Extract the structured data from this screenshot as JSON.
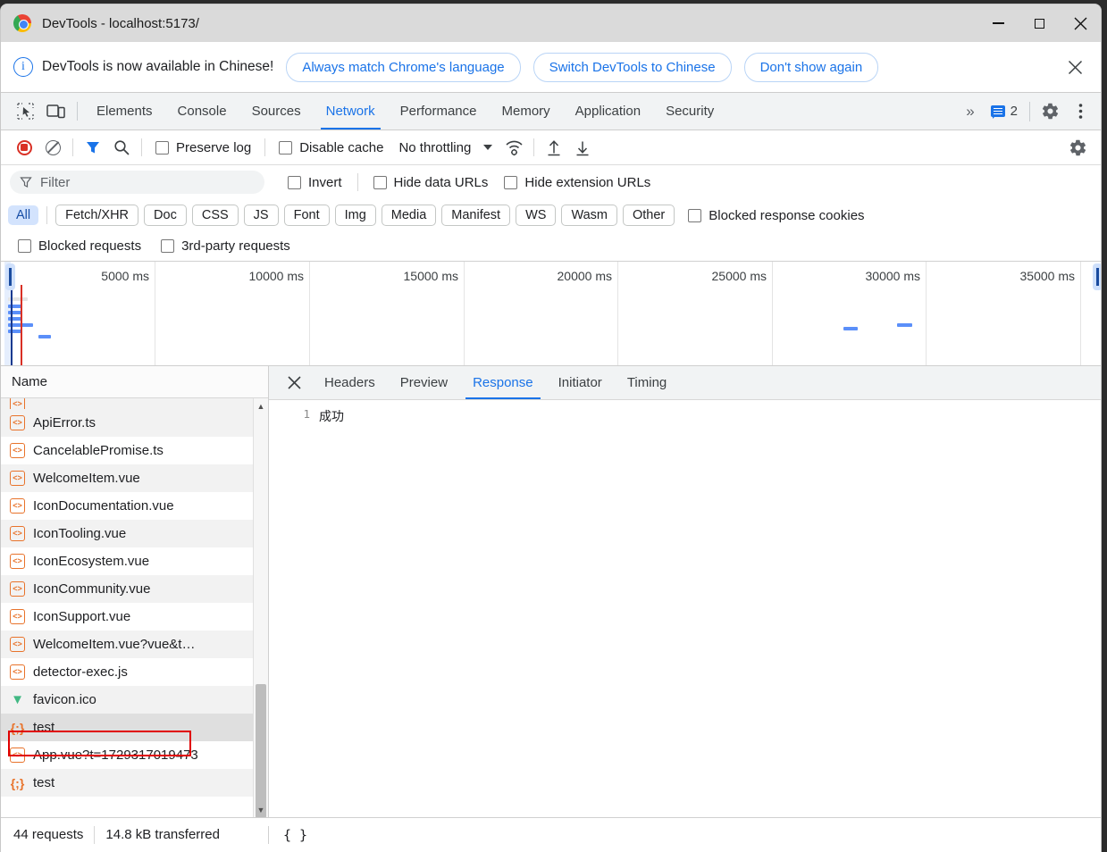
{
  "window": {
    "title": "DevTools - localhost:5173/",
    "minimize": "minimize-button",
    "maximize": "maximize-button",
    "close": "close-button"
  },
  "infobar": {
    "message": "DevTools is now available in Chinese!",
    "buttons": [
      "Always match Chrome's language",
      "Switch DevTools to Chinese",
      "Don't show again"
    ],
    "close_label": "✕"
  },
  "tabstrip": {
    "tabs": [
      "Elements",
      "Console",
      "Sources",
      "Network",
      "Performance",
      "Memory",
      "Application",
      "Security"
    ],
    "active": "Network",
    "more_label": "»",
    "message_count": "2"
  },
  "toolbar": {
    "preserve_log": "Preserve log",
    "disable_cache": "Disable cache",
    "throttling": "No throttling"
  },
  "filterbar": {
    "placeholder": "Filter",
    "invert": "Invert",
    "hide_data_urls": "Hide data URLs",
    "hide_extension_urls": "Hide extension URLs"
  },
  "chips": {
    "items": [
      "All",
      "Fetch/XHR",
      "Doc",
      "CSS",
      "JS",
      "Font",
      "Img",
      "Media",
      "Manifest",
      "WS",
      "Wasm",
      "Other"
    ],
    "active": "All",
    "blocked_response_cookies": "Blocked response cookies"
  },
  "checkrow": {
    "blocked_requests": "Blocked requests",
    "third_party_requests": "3rd-party requests"
  },
  "overview": {
    "ticks": [
      "5000 ms",
      "10000 ms",
      "15000 ms",
      "20000 ms",
      "25000 ms",
      "30000 ms",
      "35000 ms"
    ]
  },
  "requests": {
    "column_header": "Name",
    "rows": [
      {
        "name": "",
        "icon": "code-icon",
        "partial": true
      },
      {
        "name": "ApiError.ts",
        "icon": "code-icon"
      },
      {
        "name": "CancelablePromise.ts",
        "icon": "code-icon"
      },
      {
        "name": "WelcomeItem.vue",
        "icon": "code-icon"
      },
      {
        "name": "IconDocumentation.vue",
        "icon": "code-icon"
      },
      {
        "name": "IconTooling.vue",
        "icon": "code-icon"
      },
      {
        "name": "IconEcosystem.vue",
        "icon": "code-icon"
      },
      {
        "name": "IconCommunity.vue",
        "icon": "code-icon"
      },
      {
        "name": "IconSupport.vue",
        "icon": "code-icon"
      },
      {
        "name": "WelcomeItem.vue?vue&t…",
        "icon": "code-icon"
      },
      {
        "name": "detector-exec.js",
        "icon": "code-icon"
      },
      {
        "name": "favicon.ico",
        "icon": "vue-icon"
      },
      {
        "name": "test",
        "icon": "json-icon",
        "selected": true,
        "highlighted": true
      },
      {
        "name": "App.vue?t=1729317019473",
        "icon": "code-icon"
      },
      {
        "name": "test",
        "icon": "json-icon"
      }
    ]
  },
  "detail": {
    "tabs": [
      "Headers",
      "Preview",
      "Response",
      "Initiator",
      "Timing"
    ],
    "active": "Response",
    "response_lines": [
      {
        "number": "1",
        "text": "成功"
      }
    ]
  },
  "statusbar": {
    "requests": "44 requests",
    "transferred": "14.8 kB transferred",
    "format_icon": "{ }"
  },
  "colors": {
    "accent": "#1a73e8",
    "record": "#d93025",
    "highlight": "#e00000",
    "chip_active_bg": "#d3e3fd",
    "file_icon": "#e8732b",
    "vue_green": "#41b883"
  }
}
